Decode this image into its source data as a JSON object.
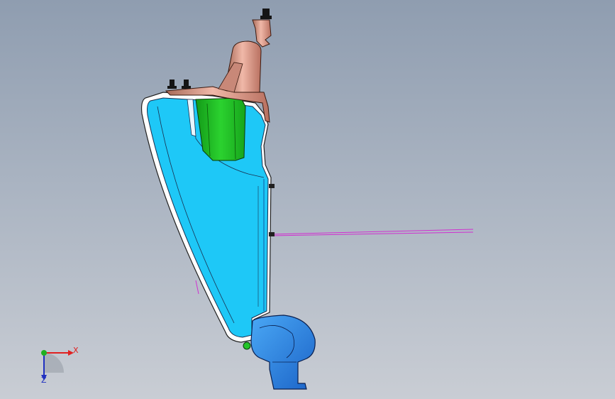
{
  "view": {
    "background_top": "#8f9db0",
    "background_bottom": "#c9cdd4"
  },
  "parts": [
    {
      "name": "housing-lens",
      "color": "#1ec8f7"
    },
    {
      "name": "reflector-bracket",
      "color": "#24c428"
    },
    {
      "name": "mounting-bracket",
      "color": "#e0a090"
    },
    {
      "name": "bottom-duct",
      "color": "#2a7fe0"
    }
  ],
  "triad": {
    "x_label": "X",
    "z_label": "Z",
    "x_color": "#e02020",
    "y_color": "#20b020",
    "z_color": "#2030c0"
  },
  "annotation_line_color": "#d030d0"
}
